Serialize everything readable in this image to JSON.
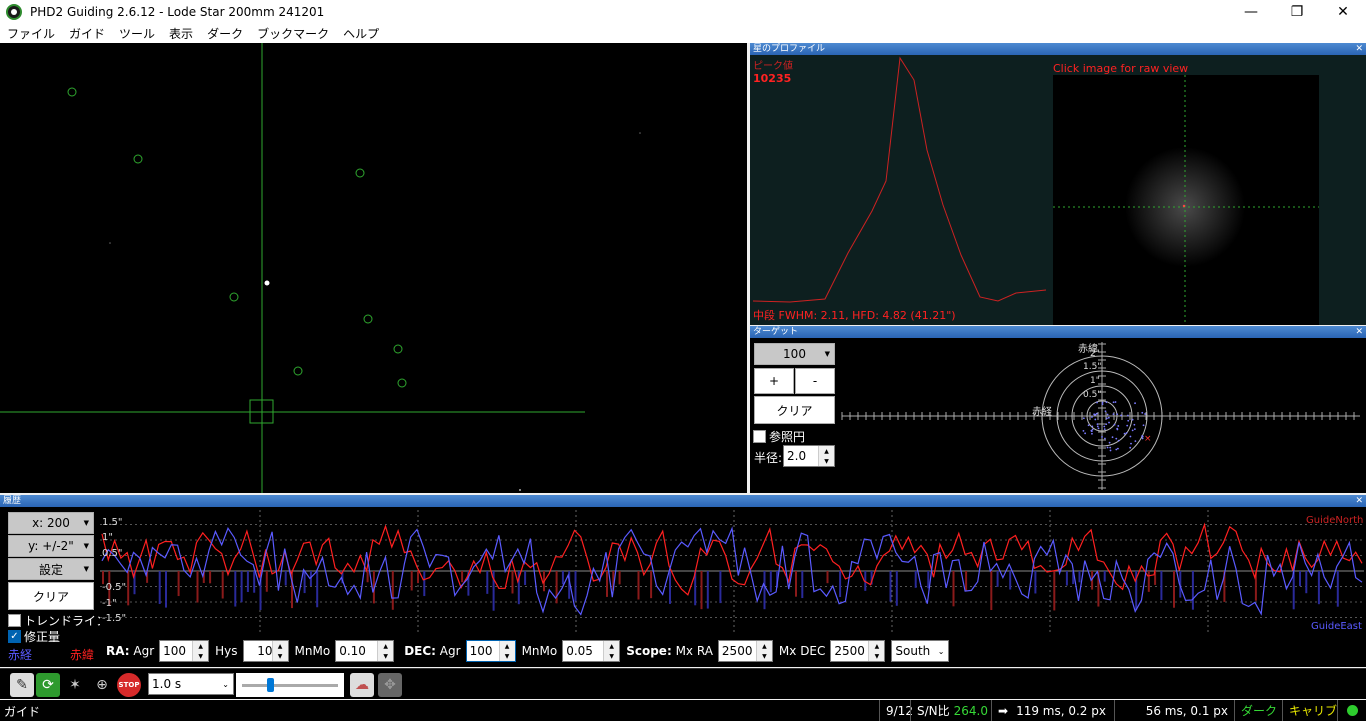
{
  "window": {
    "title": "PHD2 Guiding 2.6.12 - Lode Star 200mm 241201",
    "minimize": "—",
    "maximize": "❐",
    "close": "✕"
  },
  "menu": [
    "ファイル",
    "ガイド",
    "ツール",
    "表示",
    "ダーク",
    "ブックマーク",
    "ヘルプ"
  ],
  "profile": {
    "header": "星のプロファイル",
    "peak_label": "ピーク値",
    "peak_value": "10235",
    "click_hint": "Click image for raw view",
    "stats": "中段 FWHM: 2.11, HFD: 4.82 (41.21\")",
    "line_color": "#cc2222"
  },
  "target": {
    "header": "ターゲット",
    "zoom_value": "100",
    "plus": "+",
    "minus": "-",
    "clear": "クリア",
    "ref_circle": "参照円",
    "radius_label": "半径:",
    "radius_value": "2.0",
    "axis_dec": "赤緯",
    "axis_ra": "赤経",
    "rings": [
      "2\"",
      "1.5\"",
      "1\"",
      "0.5\""
    ]
  },
  "history": {
    "header": "履歴",
    "x_scale": "x: 200",
    "y_scale": "y: +/-2\"",
    "settings": "設定",
    "clear": "クリア",
    "trend": "トレンドライン",
    "corrections": "修正量",
    "ra_legend": "赤経",
    "dec_legend": "赤緯",
    "y_ticks": [
      "1.5\"",
      "1\"",
      "0.5\"",
      "-0.5\"",
      "-1\"",
      "-1.5\""
    ],
    "north_label": "GuideNorth",
    "east_label": "GuideEast",
    "ra_color": "#5a5aff",
    "dec_color": "#ff2020"
  },
  "controls": {
    "ra_label": "RA:",
    "agr_label": "Agr",
    "ra_agr": "100",
    "hys_label": "Hys",
    "hys_value": "10",
    "mnmo_label": "MnMo",
    "ra_mnmo": "0.10",
    "dec_label": "DEC:",
    "dec_agr": "100",
    "dec_mnmo": "0.05",
    "scope_label": "Scope:",
    "mxra_label": "Mx RA",
    "mxra_value": "2500",
    "mxdec_label": "Mx DEC",
    "mxdec_value": "2500",
    "dec_mode": "South"
  },
  "toolbar": {
    "exposure": "1.0 s",
    "stop": "STOP"
  },
  "status": {
    "mode": "ガイド",
    "frame": "9/12",
    "snr_label": "S/N比",
    "snr_value": "264.0",
    "ra_pulse": "119 ms, 0.2 px",
    "dec_pulse": "56 ms, 0.1 px",
    "dark": "ダーク",
    "calib": "キャリブ"
  }
}
